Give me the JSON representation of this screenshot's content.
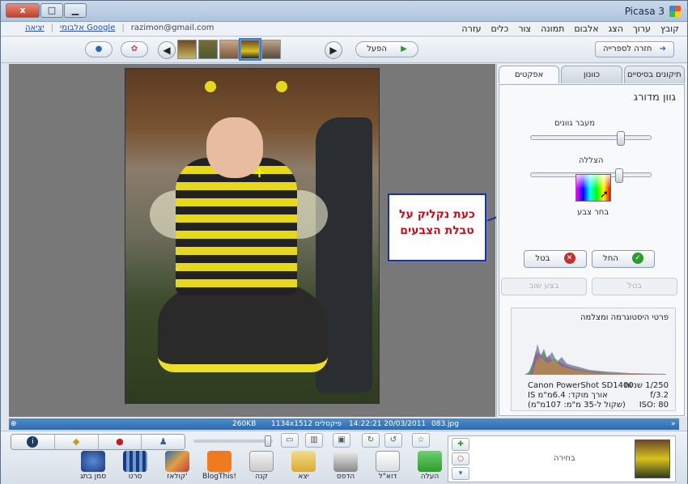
{
  "window": {
    "title": "Picasa 3",
    "buttons": {
      "close": "x",
      "maximize": "□",
      "minimize": "▁"
    }
  },
  "menubar": {
    "items": [
      "קובץ",
      "ערוך",
      "הצג",
      "אלבום",
      "תמונה",
      "צור",
      "כלים",
      "עזרה"
    ],
    "account": {
      "exit": "יציאה",
      "albums_link": "אלבומי Google",
      "email": "razimon@gmail.com"
    }
  },
  "toolbar": {
    "back_to_library": "חזרה לספרייה",
    "play": "הפעל"
  },
  "panel": {
    "tabs": [
      "תיקונים בסיסיים",
      "כוונון",
      "אפקטים"
    ],
    "active_tab": "אפקטים",
    "section_title": "גוון מדורג",
    "slider1_label": "מעבר גוונים",
    "slider1_value": 0.74,
    "slider2_label": "הצללה",
    "slider2_value": 0.72,
    "color_picker_label": "בחר צבע",
    "apply": "החל",
    "cancel": "בטל",
    "undo": "בטל",
    "redo": "בצע שוב"
  },
  "histogram": {
    "title": "פרטי היסטוגרמה ומצלמה",
    "shutter": "1/250 שניות",
    "aperture": "f/3.2",
    "iso": "ISO: 80",
    "camera": "Canon PowerShot SD1400",
    "focal_length": "אורך מוקד: 6.4מ\"מ IS",
    "focal_equiv": "(שקול ל-35 מ\"מ: 107מ\"מ)"
  },
  "callout": {
    "line1": "כעת נקליק על",
    "line2": "טבלת הצבעים"
  },
  "status": {
    "filename": "083.jpg",
    "datetime": "14:22:21 20/03/2011",
    "dimensions": "1134x1512 פיקסלים",
    "filesize": "260KB"
  },
  "tray": {
    "actions": [
      "סמן בתג",
      "סרט",
      "קולאז'",
      "BlogThis!",
      "קנה",
      "יצא",
      "הדפס",
      "דוא\"ל",
      "העלה"
    ],
    "selection_label": "בחירה"
  },
  "colors": {
    "callout_border": "#1a2fb0",
    "callout_text": "#c0121a",
    "status_bar": "#2e6aa9",
    "apply_icon": "#2e9a2e",
    "cancel_icon": "#c0302c"
  }
}
